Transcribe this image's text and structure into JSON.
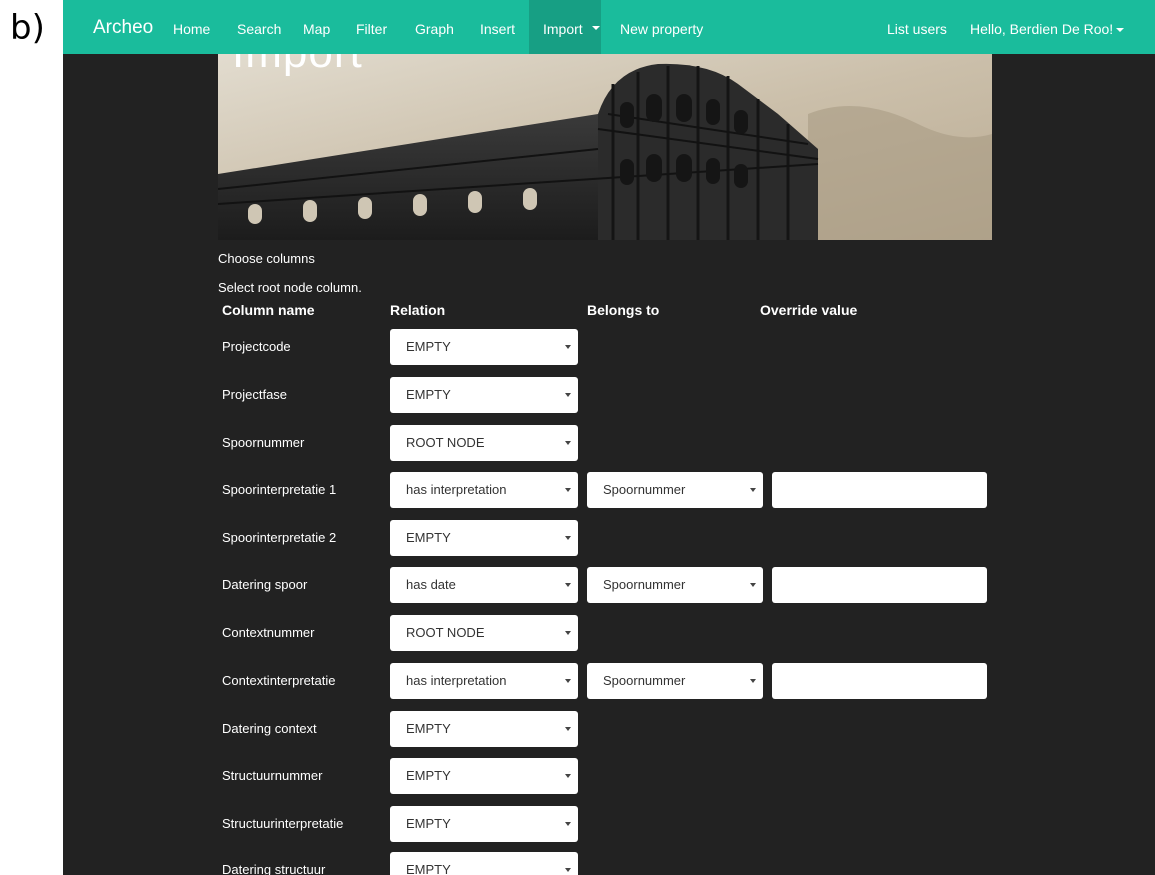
{
  "figure_label": "b)",
  "nav": {
    "brand": "Archeo",
    "items": [
      "Home",
      "Search",
      "Map",
      "Filter",
      "Graph",
      "Insert",
      "Import",
      "New property"
    ],
    "right": [
      "List users",
      "Hello, Berdien De Roo!"
    ],
    "active": "Import"
  },
  "banner": {
    "title": "Import"
  },
  "page": {
    "heading": "Choose columns",
    "instruction": "Select root node column."
  },
  "table": {
    "headers": [
      "Column name",
      "Relation",
      "Belongs to",
      "Override value"
    ],
    "rows": [
      {
        "name": "Projectcode",
        "relation": "EMPTY"
      },
      {
        "name": "Projectfase",
        "relation": "EMPTY"
      },
      {
        "name": "Spoornummer",
        "relation": "ROOT NODE"
      },
      {
        "name": "Spoorinterpretatie 1",
        "relation": "has interpretation",
        "belongs_to": "Spoornummer",
        "override": ""
      },
      {
        "name": "Spoorinterpretatie 2",
        "relation": "EMPTY"
      },
      {
        "name": "Datering spoor",
        "relation": "has date",
        "belongs_to": "Spoornummer",
        "override": ""
      },
      {
        "name": "Contextnummer",
        "relation": "ROOT NODE"
      },
      {
        "name": "Contextinterpretatie",
        "relation": "has interpretation",
        "belongs_to": "Spoornummer",
        "override": ""
      },
      {
        "name": "Datering context",
        "relation": "EMPTY"
      },
      {
        "name": "Structuurnummer",
        "relation": "EMPTY"
      },
      {
        "name": "Structuurinterpretatie",
        "relation": "EMPTY"
      },
      {
        "name": "Datering structuur",
        "relation": "EMPTY"
      }
    ]
  },
  "colors": {
    "navbar": "#1abc9c",
    "navbar_active": "#179f84",
    "page_background": "#222222"
  },
  "icons": [
    "dropdown-caret-icon",
    "select-arrow-icon"
  ]
}
